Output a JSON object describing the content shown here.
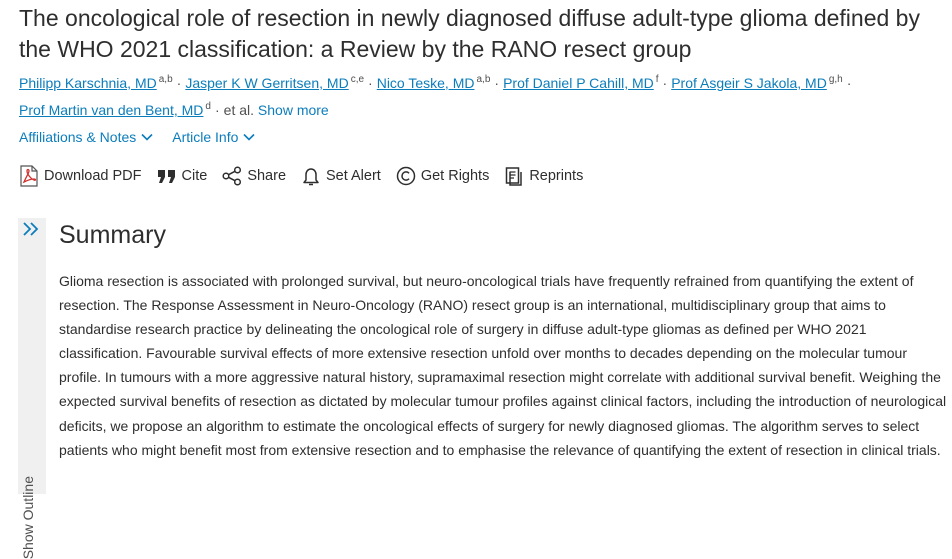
{
  "article": {
    "title": "The oncological role of resection in newly diagnosed diffuse adult-type glioma defined by the WHO 2021 classification: a Review by the RANO resect group"
  },
  "authors": [
    {
      "name": "Philipp Karschnia, MD",
      "sup": "a,b"
    },
    {
      "name": "Jasper K W Gerritsen, MD",
      "sup": "c,e"
    },
    {
      "name": "Nico Teske, MD",
      "sup": "a,b"
    },
    {
      "name": "Prof Daniel P Cahill, MD",
      "sup": "f"
    },
    {
      "name": "Prof Asgeir S Jakola, MD",
      "sup": "g,h"
    },
    {
      "name": "Prof Martin van den Bent, MD",
      "sup": "d"
    }
  ],
  "authors_suffix": "et al.",
  "show_more_label": "Show more",
  "meta": {
    "affiliations_label": "Affiliations & Notes",
    "article_info_label": "Article Info"
  },
  "toolbar": {
    "download_pdf": "Download PDF",
    "cite": "Cite",
    "share": "Share",
    "set_alert": "Set Alert",
    "get_rights": "Get Rights",
    "reprints": "Reprints"
  },
  "outline": {
    "label": "Show Outline"
  },
  "summary": {
    "heading": "Summary",
    "body": "Glioma resection is associated with prolonged survival, but neuro-oncological trials have frequently refrained from quantifying the extent of resection. The Response Assessment in Neuro-Oncology (RANO) resect group is an international, multidisciplinary group that aims to standardise research practice by delineating the oncological role of surgery in diffuse adult-type gliomas as defined per WHO 2021 classification. Favourable survival effects of more extensive resection unfold over months to decades depending on the molecular tumour profile. In tumours with a more aggressive natural history, supramaximal resection might correlate with additional survival benefit. Weighing the expected survival benefits of resection as dictated by molecular tumour profiles against clinical factors, including the introduction of neurological deficits, we propose an algorithm to estimate the oncological effects of surgery for newly diagnosed gliomas. The algorithm serves to select patients who might benefit most from extensive resection and to emphasise the relevance of quantifying the extent of resection in clinical trials."
  },
  "colors": {
    "link": "#0c7dbb",
    "text": "#2e2e2e",
    "pdf_red": "#d0312d"
  }
}
